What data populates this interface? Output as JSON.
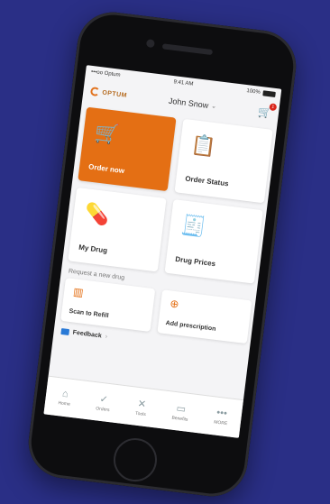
{
  "status_bar": {
    "carrier": "•••oo Optum",
    "time": "9:41 AM",
    "battery": "100%"
  },
  "header": {
    "logo": "OPTUM",
    "user": "John Snow",
    "cart_badge": "1"
  },
  "tiles": [
    {
      "label": "Order now",
      "icon": "cart-icon"
    },
    {
      "label": "Order Status",
      "icon": "document-check-icon"
    },
    {
      "label": "My Drug",
      "icon": "pill-icon"
    },
    {
      "label": "Drug Prices",
      "icon": "price-document-icon"
    }
  ],
  "section_label": "Request a new drug",
  "actions": [
    {
      "label": "Scan to Refill",
      "icon": "barcode-icon"
    },
    {
      "label": "Add prescription",
      "icon": "plus-circle-icon"
    }
  ],
  "feedback": {
    "label": "Feedback",
    "chevron": "›"
  },
  "tabs": [
    {
      "label": "Home",
      "icon": "home-icon"
    },
    {
      "label": "Orders",
      "icon": "check-circle-icon"
    },
    {
      "label": "Tools",
      "icon": "tools-icon"
    },
    {
      "label": "Benefits",
      "icon": "card-icon"
    },
    {
      "label": "MORE",
      "icon": "dots-icon"
    }
  ]
}
